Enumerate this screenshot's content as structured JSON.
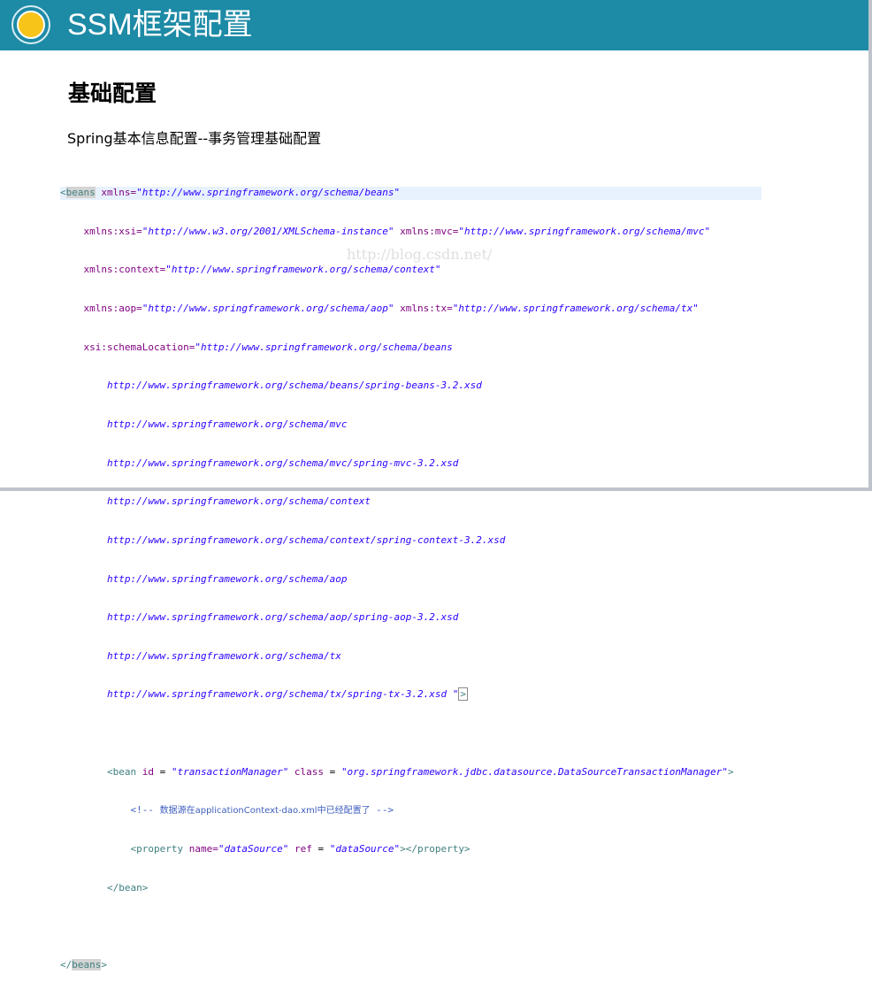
{
  "slide": {
    "title": "SSM框架配置",
    "heading": "基础配置",
    "subheading": "Spring基本信息配置--事务管理基础配置",
    "watermark": "http://blog.csdn.net/"
  },
  "code": {
    "line1": {
      "open": "<",
      "tag": "beans",
      "attr": " xmlns=",
      "val": "\"http://www.springframework.org/schema/beans\""
    },
    "line2": {
      "indent": "    ",
      "attr1": "xmlns:xsi=",
      "val1": "\"http://www.w3.org/2001/XMLSchema-instance\"",
      "attr2": " xmlns:mvc=",
      "val2": "\"http://www.springframework.org/schema/mvc\""
    },
    "line3": {
      "indent": "    ",
      "attr1": "xmlns:context=",
      "val1": "\"http://www.springframework.org/schema/context\""
    },
    "line4": {
      "indent": "    ",
      "attr1": "xmlns:aop=",
      "val1": "\"http://www.springframework.org/schema/aop\"",
      "attr2": " xmlns:tx=",
      "val2": "\"http://www.springframework.org/schema/tx\""
    },
    "line5": {
      "indent": "    ",
      "attr1": "xsi:schemaLocation=",
      "val1": "\"http://www.springframework.org/schema/beans"
    },
    "schema_lines": [
      "http://www.springframework.org/schema/beans/spring-beans-3.2.xsd",
      "http://www.springframework.org/schema/mvc",
      "http://www.springframework.org/schema/mvc/spring-mvc-3.2.xsd",
      "http://www.springframework.org/schema/context",
      "http://www.springframework.org/schema/context/spring-context-3.2.xsd",
      "http://www.springframework.org/schema/aop",
      "http://www.springframework.org/schema/aop/spring-aop-3.2.xsd",
      "http://www.springframework.org/schema/tx"
    ],
    "line_last_schema": {
      "val": "http://www.springframework.org/schema/tx/spring-tx-3.2.xsd \"",
      "close": ">"
    },
    "bean": {
      "open": "<bean",
      "id_attr": " id",
      "eq": " = ",
      "id_val": "\"transactionManager\"",
      "class_attr": " class",
      "class_val": "\"org.springframework.jdbc.datasource.DataSourceTransactionManager\"",
      "close": ">"
    },
    "comment": {
      "open": "<!-- ",
      "text": "数据源在applicationContext-dao.xml中已经配置了",
      "close": " -->"
    },
    "property": {
      "open": "<property",
      "name_attr": " name=",
      "name_val": "\"dataSource\"",
      "ref_attr": " ref",
      "eq": " = ",
      "ref_val": "\"dataSource\"",
      "close": "></property>"
    },
    "bean_close": "</bean>",
    "beans_close": {
      "open": "</",
      "tag": "beans",
      "close": ">"
    }
  }
}
